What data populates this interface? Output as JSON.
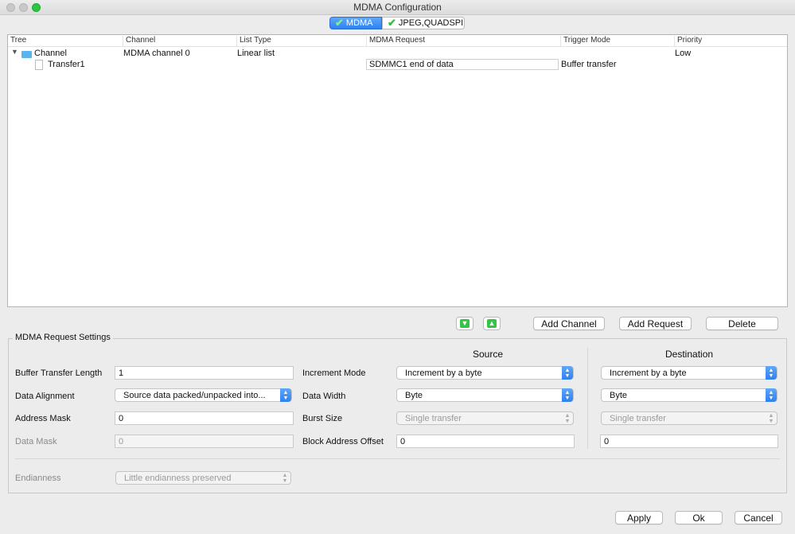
{
  "window": {
    "title": "MDMA Configuration"
  },
  "tabs": [
    {
      "label": "MDMA"
    },
    {
      "label": "JPEG,QUADSPI"
    }
  ],
  "table": {
    "columns": [
      "Tree",
      "Channel",
      "List Type",
      "MDMA Request",
      "Trigger Mode",
      "Priority"
    ],
    "channel_row": {
      "tree": "Channel",
      "channel": "MDMA channel 0",
      "list_type": "Linear list",
      "priority": "Low"
    },
    "transfer_row": {
      "tree": "Transfer1",
      "request": "SDMMC1 end of data",
      "trigger": "Buffer transfer"
    }
  },
  "actions": {
    "add_channel": "Add Channel",
    "add_request": "Add Request",
    "delete": "Delete"
  },
  "settings": {
    "title": "MDMA Request Settings",
    "source_header": "Source",
    "destination_header": "Destination",
    "buffer_transfer_length_label": "Buffer Transfer Length",
    "buffer_transfer_length": "1",
    "data_alignment_label": "Data Alignment",
    "data_alignment": "Source data packed/unpacked into...",
    "address_mask_label": "Address Mask",
    "address_mask": "0",
    "data_mask_label": "Data Mask",
    "data_mask": "0",
    "increment_mode_label": "Increment Mode",
    "data_width_label": "Data Width",
    "burst_size_label": "Burst Size",
    "block_address_offset_label": "Block Address Offset",
    "source": {
      "increment_mode": "Increment by a byte",
      "data_width": "Byte",
      "burst_size": "Single transfer",
      "block_offset": "0"
    },
    "destination": {
      "increment_mode": "Increment by a byte",
      "data_width": "Byte",
      "burst_size": "Single transfer",
      "block_offset": "0"
    },
    "endianness_label": "Endianness",
    "endianness": "Little endianness preserved"
  },
  "footer": {
    "apply": "Apply",
    "ok": "Ok",
    "cancel": "Cancel"
  }
}
